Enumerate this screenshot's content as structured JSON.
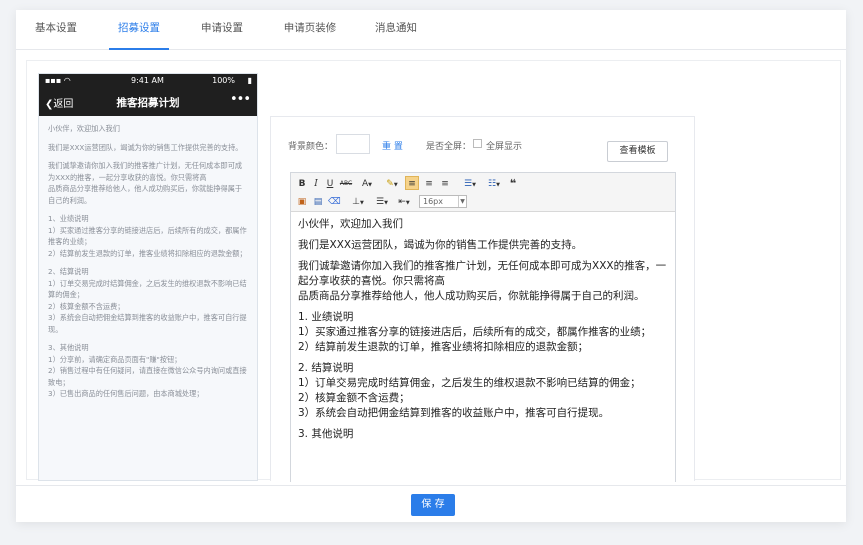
{
  "tabs": [
    {
      "label": "基本设置"
    },
    {
      "label": "招募设置"
    },
    {
      "label": "申请设置"
    },
    {
      "label": "申请页装修"
    },
    {
      "label": "消息通知"
    }
  ],
  "active_tab": "招募设置",
  "phone": {
    "time": "9:41 AM",
    "battery": "100%",
    "back_label": "返回",
    "title": "推客招募计划",
    "more": "•••",
    "paragraphs": [
      "小伙伴，欢迎加入我们",
      "我们是XXX运营团队，竭诚为你的销售工作提供完善的支持。",
      "我们诚挚邀请你加入我们的推客推广计划，无任何成本即可成为XXX的推客，一起分享收获的喜悦。你只需将高",
      "品质商品分享推荐给他人，他人成功购买后，你就能挣得属于自己的利润。"
    ],
    "groups": [
      [
        "1、业绩说明",
        "1）买家通过推客分享的链接进店后，后续所有的成交，都属作推客的业绩；",
        "2）结算前发生退款的订单，推客业绩将扣除相应的退款金额；"
      ],
      [
        "2、结算说明",
        "1）订单交易完成时结算佣金，之后发生的维权退款不影响已结算的佣金；",
        "2）核算金额不含运费；",
        "3）系统会自动把佣金结算到推客的收益账户中，推客可自行提现。"
      ],
      [
        "3、其他说明",
        "1）分享前，请确定商品页面有\"赚\"按钮；",
        "2）销售过程中有任何疑问，请直接在微信公众号内询问或直接致电；",
        "3）已售出商品的任何售后问题，由本商城处理；"
      ]
    ]
  },
  "settings": {
    "bg_color_label": "背景颜色：",
    "reset_label": "重 置",
    "fullscreen_label": "是否全屏：",
    "fullscreen_option": "全屏显示",
    "fullscreen_checked": false,
    "view_template_label": "查看模板"
  },
  "toolbar": {
    "bold": "B",
    "italic": "I",
    "underline": "U",
    "strike": "ABC",
    "font_color": "A",
    "quote": "❝",
    "font_size": "16px"
  },
  "editor": {
    "title": "小伙伴，欢迎加入我们",
    "intro": "我们是XXX运营团队，竭诚为你的销售工作提供完善的支持。",
    "invite_1": "我们诚挚邀请你加入我们的推客推广计划，无任何成本即可成为XXX的推客，一起分享收获的喜悦。你只需将高",
    "invite_2": "品质商品分享推荐给他人，他人成功购买后，你就能挣得属于自己的利润。",
    "groups": [
      [
        "1. 业绩说明",
        "1）买家通过推客分享的链接进店后，后续所有的成交，都属作推客的业绩；",
        "2）结算前发生退款的订单，推客业绩将扣除相应的退款金额；"
      ],
      [
        "2. 结算说明",
        "1）订单交易完成时结算佣金，之后发生的维权退款不影响已结算的佣金；",
        "2）核算金额不含运费；",
        "3）系统会自动把佣金结算到推客的收益账户中，推客可自行提现。"
      ],
      [
        "3. 其他说明"
      ]
    ]
  },
  "footer": {
    "save_label": "保 存"
  },
  "colors": {
    "accent": "#2b7de9",
    "phone_header": "#1f1f1f",
    "phone_bg": "#f6f8fb"
  }
}
